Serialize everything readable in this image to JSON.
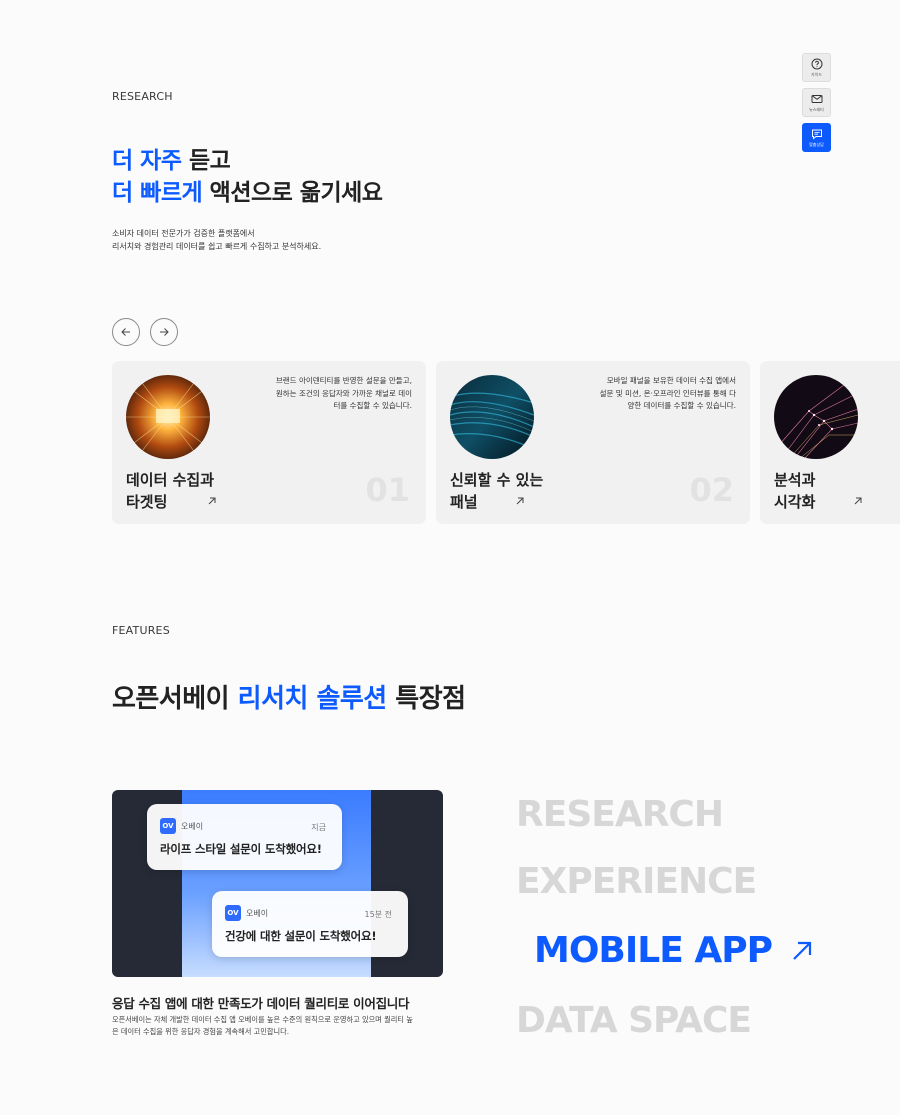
{
  "side_buttons": [
    {
      "label": "가이드",
      "icon": "question-icon"
    },
    {
      "label": "뉴스레터",
      "icon": "mail-icon"
    },
    {
      "label": "맞춤상담",
      "icon": "chat-icon"
    }
  ],
  "research": {
    "eyebrow": "RESEARCH",
    "heading_line1_accent": "더 자주",
    "heading_line1_rest": " 듣고",
    "heading_line2_accent": "더 빠르게",
    "heading_line2_rest": " 액션으로 옮기세요",
    "desc_line1": "소비자 데이터 전문가가 검증한 플랫폼에서",
    "desc_line2": "리서치와 경험관리 데이터를 쉽고 빠르게 수집하고 분석하세요."
  },
  "cards": [
    {
      "title_line1": "데이터 수집과",
      "title_line2": "타겟팅",
      "number": "01",
      "text_line1": "브랜드 아이덴티티를 반영한 설문을 만들고,",
      "text_line2": "원하는 조건의 응답자와 가까운 채널로 데이",
      "text_line3": "터를 수집할 수 있습니다."
    },
    {
      "title_line1": "신뢰할 수 있는",
      "title_line2": "패널",
      "number": "02",
      "text_line1": "모바일 패널을 보유한 데이터 수집 앱에서",
      "text_line2": "설문 및 미션, 온·오프라인 인터뷰를 통해 다",
      "text_line3": "양한 데이터를 수집할 수 있습니다."
    },
    {
      "title_line1": "분석과",
      "title_line2": "시각화",
      "number": "",
      "text_line1": "",
      "text_line2": "",
      "text_line3": ""
    }
  ],
  "features": {
    "eyebrow": "FEATURES",
    "heading_pre": "오픈서베이 ",
    "heading_accent": "리서치 솔루션",
    "heading_post": " 특장점",
    "notifications": [
      {
        "logo": "OV",
        "app": "오베이",
        "time": "지금",
        "message": "라이프 스타일 설문이 도착했어요!"
      },
      {
        "logo": "OV",
        "app": "오베이",
        "time": "15분 전",
        "message": "건강에 대한 설문이 도착했어요!"
      }
    ],
    "feature_title": "응답 수집 앱에 대한 만족도가 데이터 퀄리티로 이어집니다",
    "feature_desc_line1": "오픈서베이는 자체 개발한 데이터 수집 앱 오베이를 높은 수준의 원칙으로 운영하고 있으며 퀄리티 높",
    "feature_desc_line2": "은 데이터 수집을 위한 응답자 경험을 계속해서 고민합니다.",
    "menu": [
      {
        "label": "RESEARCH",
        "active": false
      },
      {
        "label": "EXPERIENCE",
        "active": false
      },
      {
        "label": "MOBILE APP",
        "active": true
      },
      {
        "label": "DATA SPACE",
        "active": false
      }
    ]
  },
  "colors": {
    "accent": "#0d5bff",
    "card_bg": "#f1f1f1",
    "muted_menu": "#d7d7d7"
  }
}
